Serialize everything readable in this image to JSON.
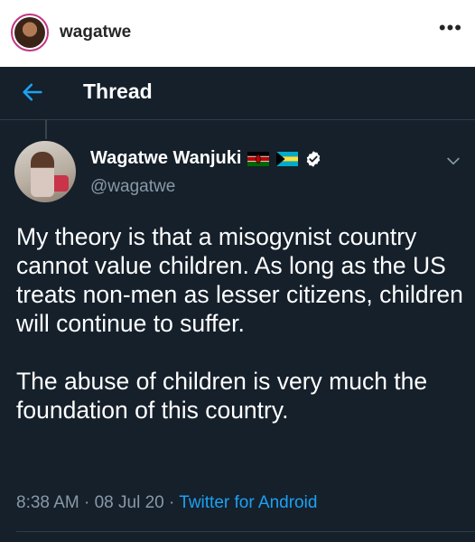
{
  "instagram": {
    "username": "wagatwe",
    "more_icon": "more-horizontal-icon"
  },
  "header": {
    "back_icon": "arrow-left-icon",
    "title": "Thread"
  },
  "tweet": {
    "display_name": "Wagatwe Wanjuki",
    "flags": [
      "kenya-flag",
      "bahamas-flag"
    ],
    "verified_icon": "verified-badge-icon",
    "handle": "@wagatwe",
    "body": "My theory is that a misogynist country cannot value children. As long as the US treats non-men as lesser citizens, children will continue to suffer.\n\nThe abuse of children is very much the foundation of this country.",
    "time": "8:38 AM",
    "separator": "·",
    "date": "08 Jul 20",
    "source": "Twitter for Android"
  },
  "colors": {
    "background": "#15202b",
    "accent": "#1da1f2",
    "secondary_text": "#8899a6"
  }
}
